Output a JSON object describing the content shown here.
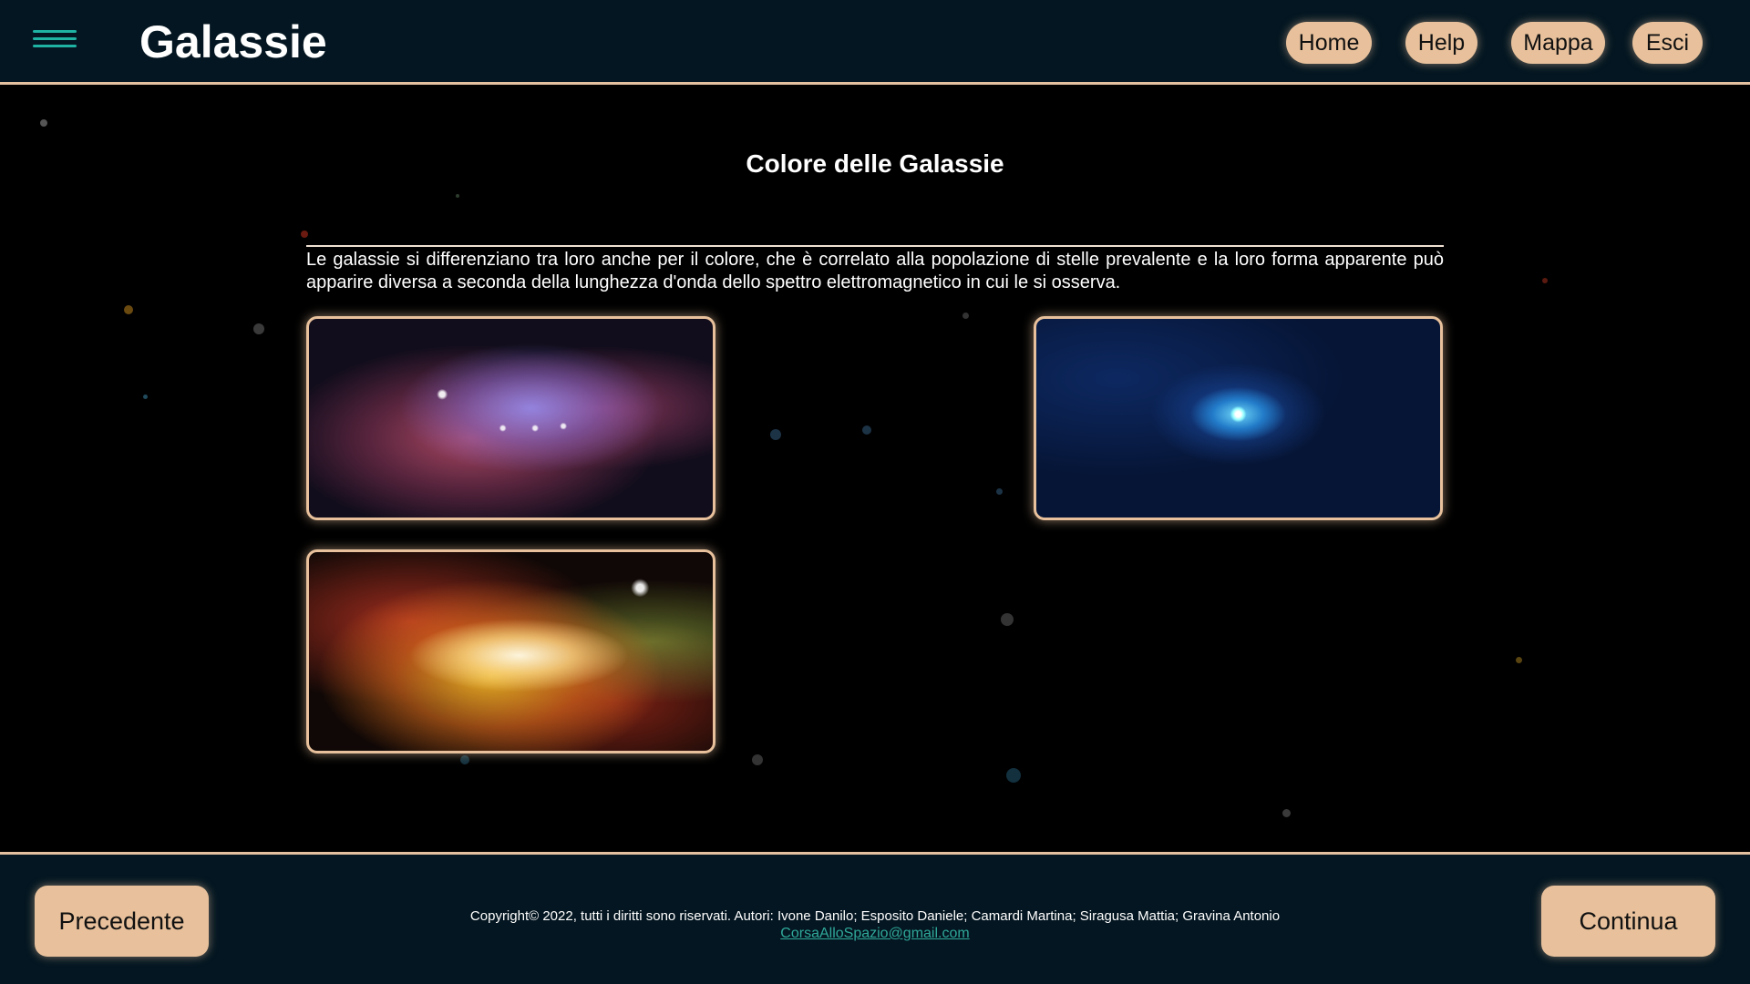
{
  "header": {
    "title": "Galassie",
    "nav": [
      {
        "label": "Home"
      },
      {
        "label": "Help"
      },
      {
        "label": "Mappa"
      },
      {
        "label": "Esci"
      }
    ]
  },
  "main": {
    "heading": "Colore delle Galassie",
    "intro": "Le galassie si differenziano tra loro anche per il colore, che è correlato alla popolazione di stelle prevalente e la loro forma apparente può apparire diversa a seconda della lunghezza d'onda dello spettro elettromagnetico in cui le si osserva."
  },
  "footer": {
    "prev_label": "Precedente",
    "next_label": "Continua",
    "copyright": "Copyright© 2022, tutti i diritti sono riservati. Autori: Ivone Danilo; Esposito Daniele; Camardi Martina; Siragusa Mattia; Gravina Antonio",
    "email": "CorsaAlloSpazio@gmail.com"
  },
  "colors": {
    "background": "#000000",
    "bar": "#041621",
    "accent": "#e8c19c",
    "menu_icon": "#1fb3a4",
    "link": "#2fa89a"
  }
}
